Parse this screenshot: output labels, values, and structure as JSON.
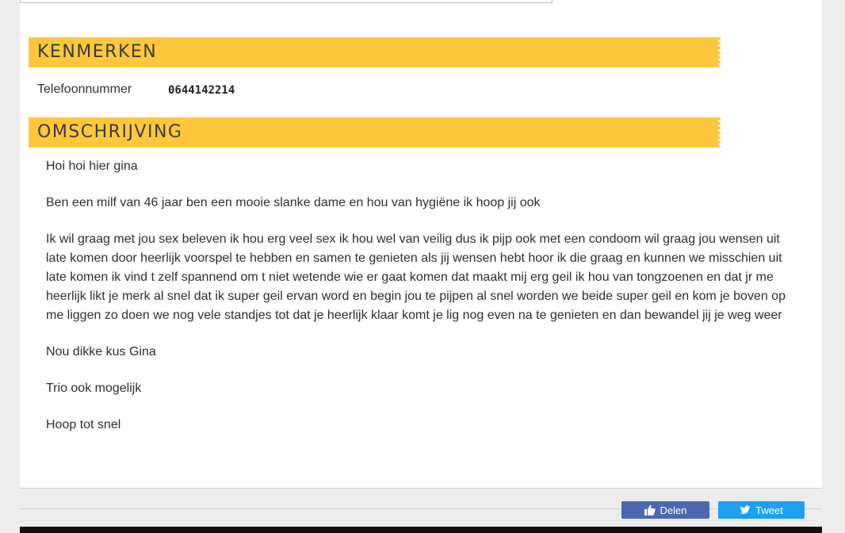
{
  "features": {
    "title": "KENMERKEN",
    "phone_label": "Telefoonnummer",
    "phone_value": "0644142214"
  },
  "description": {
    "title": "OMSCHRIJVING",
    "paragraphs": [
      "Hoi hoi hier gina",
      "Ben een milf van 46 jaar ben een mooie slanke dame en hou van hygiëne ik hoop jij ook",
      "Ik wil graag met jou sex beleven ik hou erg veel sex ik hou wel van veilig dus ik pijp ook met een condoom wil graag jou wensen uit late komen door heerlijk voorspel te hebben en samen te genieten als jij wensen hebt hoor ik die graag en kunnen we misschien uit late komen ik vind t zelf spannend om t niet wetende wie er gaat komen dat maakt mij erg geil ik hou van tongzoenen en dat jr me heerlijk likt je merk al snel dat ik super geil ervan word en begin jou te pijpen al snel worden we beide super geil en kom je boven op me liggen zo doen we nog vele standjes tot dat je heerlijk klaar komt je lig nog even na te genieten en dan bewandel jij je weg weer",
      "Nou dikke kus Gina",
      "Trio ook mogelijk",
      "Hoop tot  snel"
    ]
  },
  "share": {
    "facebook_label": "Delen",
    "twitter_label": "Tweet",
    "facebook_icon": "thumbs-up-icon",
    "twitter_icon": "twitter-bird-icon"
  },
  "colors": {
    "accent": "#fdc93a",
    "facebook": "#4b68b0",
    "twitter": "#1da1f2"
  }
}
